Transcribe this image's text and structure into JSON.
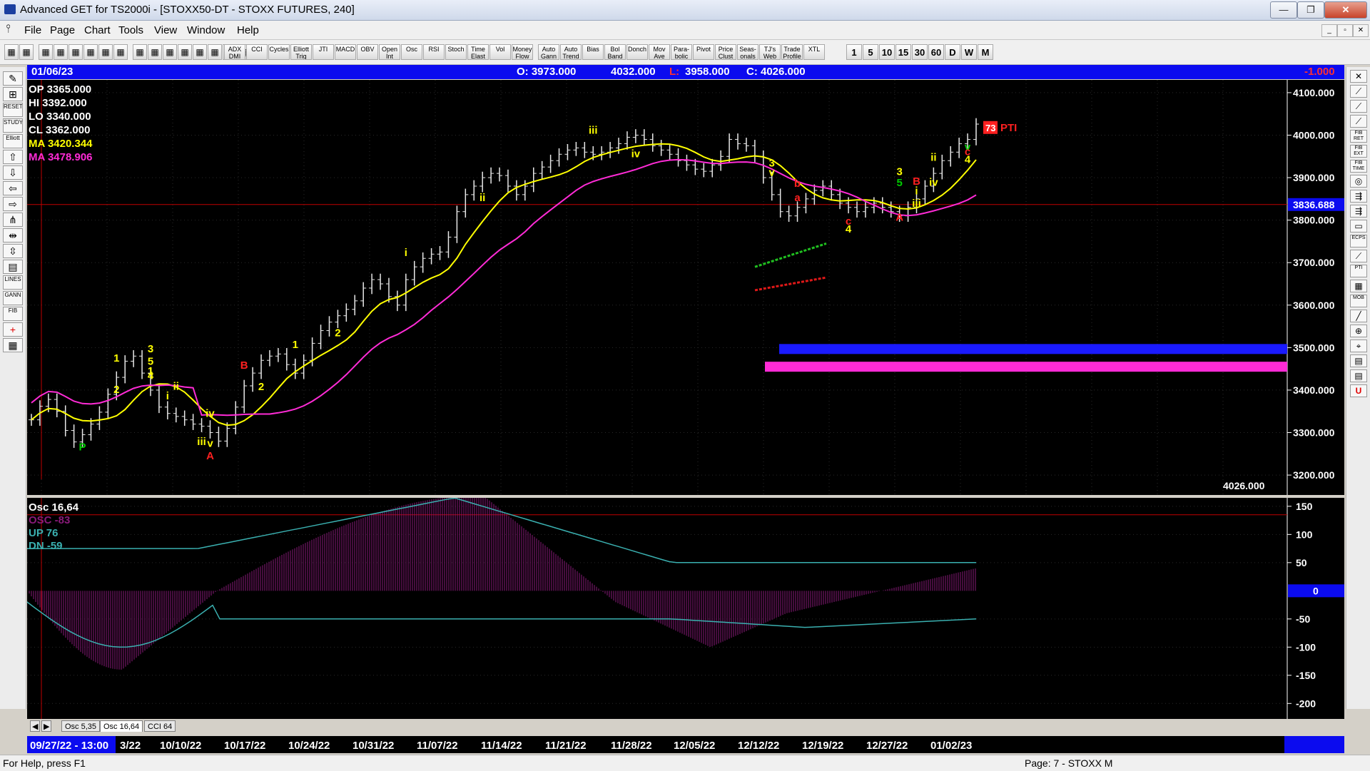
{
  "window": {
    "title": "Advanced GET for TS2000i - [STOXX50-DT - STOXX FUTURES, 240]",
    "minimize": "—",
    "maximize": "❐",
    "close": "✕"
  },
  "menu": [
    "File",
    "Page",
    "Chart",
    "Tools",
    "View",
    "Window",
    "Help"
  ],
  "toolbar": {
    "indicators": [
      "ADX DMI",
      "CCI",
      "Cycles",
      "Elliott Trig",
      "JTI",
      "MACD",
      "OBV",
      "Open Int",
      "Osc",
      "RSI",
      "Stoch",
      "Time Elast",
      "Vol",
      "Money Flow",
      "Auto Gann",
      "Auto Trend",
      "Bias",
      "Bol Band",
      "Donch",
      "Mov Ave",
      "Para- bolic",
      "Pivot",
      "Price Clust",
      "Seas- onals",
      "TJ's Web",
      "Trade Profile",
      "XTL"
    ],
    "intervals": [
      "1",
      "5",
      "10",
      "15",
      "30",
      "60",
      "D",
      "W",
      "M"
    ]
  },
  "header": {
    "date": "01/06/23",
    "open": "O: 3973.000",
    "high": "4032.000",
    "low_label": "L:",
    "low": "3958.000",
    "close": "C: 4026.000",
    "change": "-1.000"
  },
  "ohlc_box": {
    "op": "OP  3365.000",
    "hi": "HI   3392.000",
    "lo": "LO  3340.000",
    "cl": "CL  3362.000",
    "ma1": "MA  3420.344",
    "ma2": "MA  3478.906"
  },
  "price_axis": [
    "4100.000",
    "4000.000",
    "3900.000",
    "3800.000",
    "3700.000",
    "3600.000",
    "3500.000",
    "3400.000",
    "3300.000",
    "3200.000"
  ],
  "current_price_tag": "3836.688",
  "last_price_label": "4026.000",
  "pti": {
    "value": "73",
    "label": "PTI"
  },
  "elliott_labels": [
    {
      "t": "P",
      "c": "#00cc00"
    },
    {
      "t": "2",
      "c": "#ffff00"
    },
    {
      "t": "1",
      "c": "#ffff00"
    },
    {
      "t": "1",
      "c": "#ffff00"
    },
    {
      "t": "5",
      "c": "#ffff00"
    },
    {
      "t": "3",
      "c": "#ffff00"
    },
    {
      "t": "4",
      "c": "#ffff00"
    },
    {
      "t": "ii",
      "c": "#ffff00"
    },
    {
      "t": "i",
      "c": "#ffff00"
    },
    {
      "t": "iv",
      "c": "#ffff00"
    },
    {
      "t": "iii",
      "c": "#ffff00"
    },
    {
      "t": "v",
      "c": "#ffff00"
    },
    {
      "t": "A",
      "c": "#ff2020"
    },
    {
      "t": "B",
      "c": "#ff2020"
    },
    {
      "t": "2",
      "c": "#ffff00"
    },
    {
      "t": "1",
      "c": "#ffff00"
    },
    {
      "t": "2",
      "c": "#ffff00"
    },
    {
      "t": "i",
      "c": "#ffff00"
    },
    {
      "t": "ii",
      "c": "#ffff00"
    },
    {
      "t": "iii",
      "c": "#ffff00"
    },
    {
      "t": "iv",
      "c": "#ffff00"
    },
    {
      "t": "3",
      "c": "#ffff00"
    },
    {
      "t": "v",
      "c": "#ffff00"
    },
    {
      "t": "b",
      "c": "#ff2020"
    },
    {
      "t": "a",
      "c": "#ff2020"
    },
    {
      "t": "c",
      "c": "#ff2020"
    },
    {
      "t": "4",
      "c": "#ffff00"
    },
    {
      "t": "3",
      "c": "#ffff00"
    },
    {
      "t": "5",
      "c": "#00cc00"
    },
    {
      "t": "A",
      "c": "#ff2020"
    },
    {
      "t": "B",
      "c": "#ff2020"
    },
    {
      "t": "i",
      "c": "#ffff00"
    },
    {
      "t": "ii",
      "c": "#ffff00"
    },
    {
      "t": "iii",
      "c": "#ffff00"
    },
    {
      "t": "iv",
      "c": "#ffff00"
    },
    {
      "t": "v",
      "c": "#00cc00"
    },
    {
      "t": "c",
      "c": "#ff2020"
    },
    {
      "t": "4",
      "c": "#ffff00"
    }
  ],
  "oscillator": {
    "title": "Osc 16,64",
    "osc": "OSC  -83",
    "up": "UP    76",
    "dn": "DN   -59",
    "axis": [
      "150",
      "100",
      "50",
      "-50",
      "-100",
      "-150",
      "-200"
    ],
    "zero_tag": "0"
  },
  "tabs": [
    "Osc 5,35",
    "Osc 16,64",
    "CCI 64"
  ],
  "dates": [
    "09/27/22 - 13:00",
    "3/22",
    "10/10/22",
    "10/17/22",
    "10/24/22",
    "10/31/22",
    "11/07/22",
    "11/14/22",
    "11/21/22",
    "11/28/22",
    "12/05/22",
    "12/12/22",
    "12/19/22",
    "12/27/22",
    "01/02/23"
  ],
  "status": {
    "left": "For Help, press F1",
    "right": "Page: 7 - STOXX M"
  },
  "colors": {
    "yellow_ma": "#ffff00",
    "magenta_ma": "#ff2bd6",
    "info_blue": "#0b0bef",
    "cyan_line": "#3ab0b0"
  },
  "price_series": [
    3330,
    3362,
    3378,
    3350,
    3305,
    3278,
    3295,
    3320,
    3348,
    3390,
    3430,
    3468,
    3480,
    3440,
    3400,
    3360,
    3345,
    3338,
    3330,
    3320,
    3315,
    3300,
    3280,
    3310,
    3360,
    3410,
    3440,
    3470,
    3480,
    3485,
    3460,
    3440,
    3470,
    3510,
    3540,
    3560,
    3575,
    3590,
    3610,
    3640,
    3660,
    3650,
    3620,
    3600,
    3660,
    3690,
    3710,
    3720,
    3725,
    3760,
    3820,
    3860,
    3880,
    3900,
    3910,
    3905,
    3880,
    3860,
    3880,
    3910,
    3925,
    3940,
    3955,
    3965,
    3970,
    3960,
    3955,
    3960,
    3970,
    3980,
    3995,
    4000,
    3990,
    3975,
    3965,
    3955,
    3940,
    3930,
    3920,
    3915,
    3930,
    3950,
    3990,
    3980,
    3975,
    3950,
    3900,
    3860,
    3820,
    3810,
    3830,
    3850,
    3870,
    3880,
    3860,
    3840,
    3830,
    3820,
    3830,
    3840,
    3830,
    3820,
    3810,
    3830,
    3850,
    3880,
    3910,
    3940,
    3960,
    3980,
    3990,
    4026
  ]
}
